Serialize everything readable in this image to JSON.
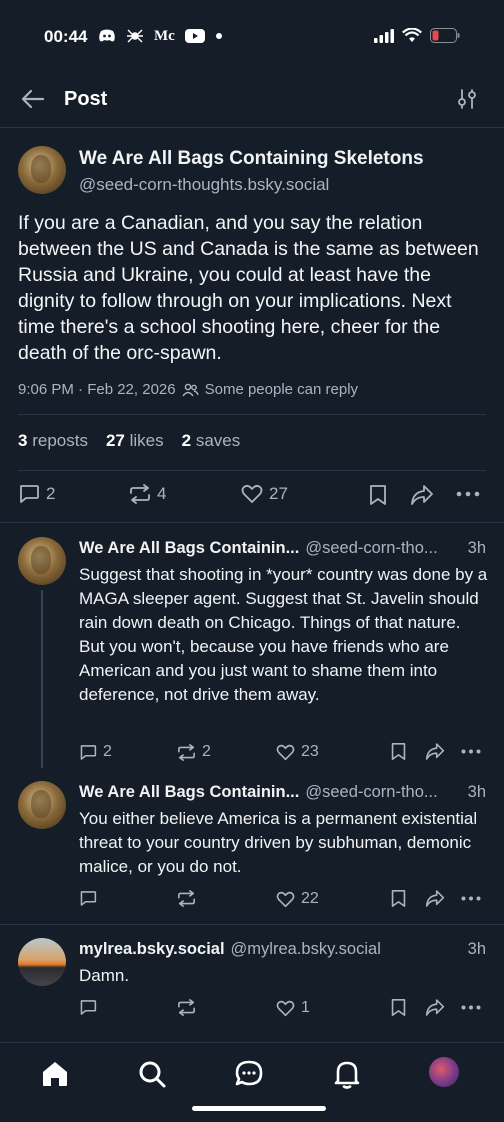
{
  "status_bar": {
    "time": "00:44",
    "app_icons": [
      "discord-icon",
      "spider-icon",
      "mc-icon",
      "youtube-icon",
      "dot-icon"
    ],
    "mc_text": "Mc"
  },
  "header": {
    "title": "Post"
  },
  "post": {
    "author_name": "We Are All Bags Containing Skeletons",
    "author_handle": "@seed-corn-thoughts.bsky.social",
    "text": "If you are a Canadian, and you say the relation between the US and Canada is the same as between Russia and Ukraine, you could at least have the dignity to follow through on your implications.  Next time there's a school shooting here, cheer for the death of the orc-spawn.",
    "timestamp": "9:06 PM · Feb 22, 2026",
    "reply_setting": "Some people can reply",
    "reposts_count": "3",
    "reposts_label": "reposts",
    "likes_count": "27",
    "likes_label": "likes",
    "saves_count": "2",
    "saves_label": "saves",
    "actions": {
      "replies": "2",
      "reposts": "4",
      "likes": "27"
    }
  },
  "replies": [
    {
      "name": "We Are All Bags Containin...",
      "handle": "@seed-corn-tho...",
      "time": "3h",
      "text": "Suggest that shooting in *your* country was done by a MAGA sleeper agent.  Suggest that St. Javelin should rain down death on Chicago.  Things of that nature.\nBut you won't, because you have friends who are American and you just want to shame them into deference, not drive them away.",
      "replies": "2",
      "reposts": "2",
      "likes": "23"
    },
    {
      "name": "We Are All Bags Containin...",
      "handle": "@seed-corn-tho...",
      "time": "3h",
      "text": "You either believe America is a permanent existential threat to your country driven by subhuman, demonic malice, or you do not.",
      "replies": "",
      "reposts": "",
      "likes": "22"
    },
    {
      "name": "mylrea.bsky.social",
      "handle": "@mylrea.bsky.social",
      "time": "3h",
      "text": "Damn.",
      "replies": "",
      "reposts": "",
      "likes": "1"
    }
  ],
  "colors": {
    "background": "#151d28",
    "text": "#f1f3f5",
    "muted": "#aab4c1",
    "divider": "#2a3444"
  }
}
